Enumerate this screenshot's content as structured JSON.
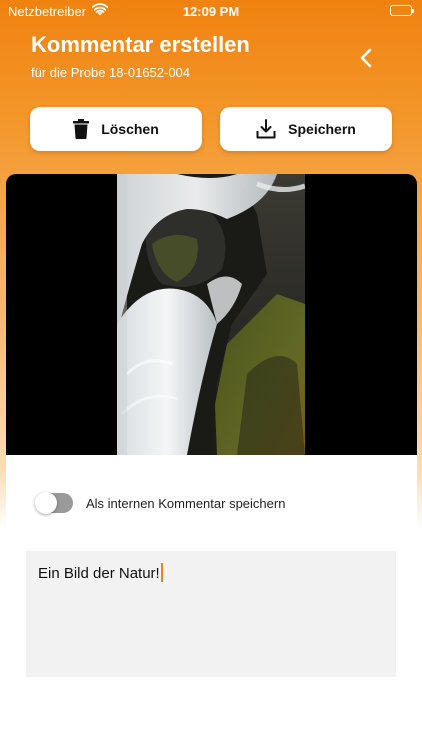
{
  "status_bar": {
    "carrier": "Netzbetreiber",
    "time": "12:09 PM",
    "icons": [
      "wifi-icon",
      "battery-icon"
    ]
  },
  "header": {
    "title": "Kommentar erstellen",
    "subtitle": "für die Probe 18-01652-004",
    "back_icon": "chevron-left-icon"
  },
  "actions": {
    "delete_label": "Löschen",
    "delete_icon": "trash-icon",
    "save_label": "Speichern",
    "save_icon": "download-icon"
  },
  "image": {
    "subject": "waterfall-photo"
  },
  "internal_toggle": {
    "label": "Als internen Kommentar speichern",
    "checked": false
  },
  "comment": {
    "value": "Ein Bild der Natur!"
  },
  "colors": {
    "accent": "#f0820f",
    "header_gradient_top": "#f0820f",
    "toggle_off": "#9a9a9a",
    "comment_bg": "#f2f2f2"
  }
}
